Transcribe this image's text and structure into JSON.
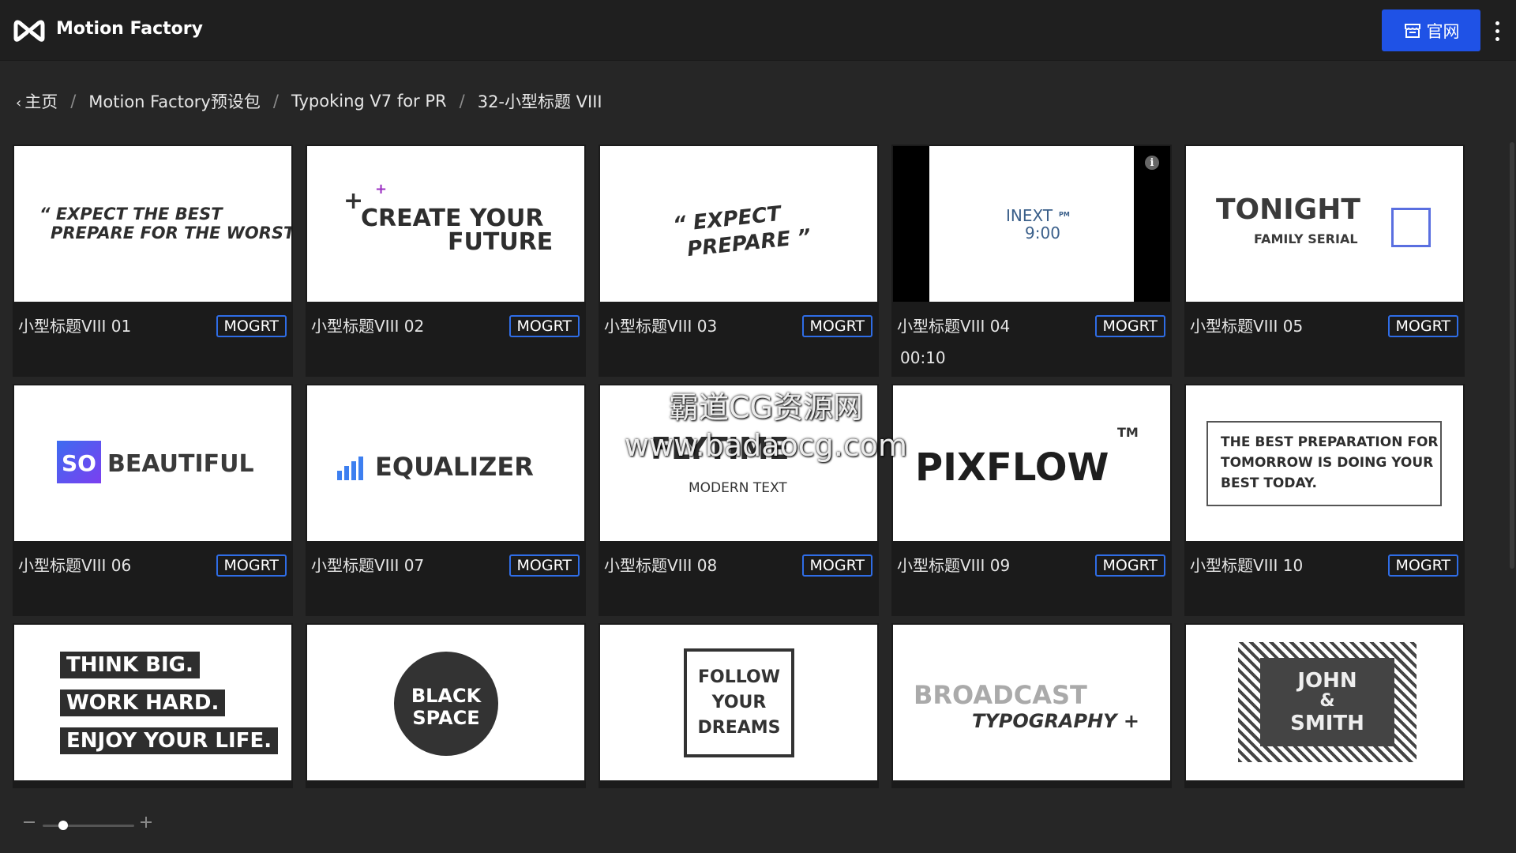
{
  "header": {
    "app_title": "Motion Factory",
    "web_button_label": "官网",
    "icons": {
      "logo": "motion-factory-logo",
      "web": "storefront-icon",
      "more": "more-vertical-icon"
    }
  },
  "breadcrumb": {
    "items": [
      "主页",
      "Motion Factory预设包",
      "Typoking V7 for PR",
      "32-小型标题 VIII"
    ],
    "separator": "/"
  },
  "cards": [
    {
      "label": "小型标题VIII 01",
      "badge": "MOGRT",
      "thumb": {
        "lines": [
          "“ EXPECT THE BEST",
          "PREPARE FOR THE WORST ”"
        ]
      }
    },
    {
      "label": "小型标题VIII 02",
      "badge": "MOGRT",
      "thumb": {
        "lines": [
          "CREATE YOUR",
          "FUTURE"
        ]
      }
    },
    {
      "label": "小型标题VIII 03",
      "badge": "MOGRT",
      "thumb": {
        "lines": [
          "“ EXPECT",
          "PREPARE ”"
        ]
      }
    },
    {
      "label": "小型标题VIII 04",
      "badge": "MOGRT",
      "time": "00:10",
      "thumb": {
        "lines": [
          "INEXT",
          "9:00"
        ],
        "sup": "PM"
      }
    },
    {
      "label": "小型标题VIII 05",
      "badge": "MOGRT",
      "thumb": {
        "lines": [
          "TONIGHT",
          "FAMILY SERIAL"
        ]
      }
    },
    {
      "label": "小型标题VIII 06",
      "badge": "MOGRT",
      "thumb": {
        "lines": [
          "SO",
          "BEAUTIFUL"
        ]
      }
    },
    {
      "label": "小型标题VIII 07",
      "badge": "MOGRT",
      "thumb": {
        "lines": [
          "EQUALIZER"
        ]
      }
    },
    {
      "label": "小型标题VIII 08",
      "badge": "MOGRT",
      "thumb": {
        "lines": [
          "FLYTIME",
          "MODERN TEXT"
        ]
      }
    },
    {
      "label": "小型标题VIII 09",
      "badge": "MOGRT",
      "thumb": {
        "lines": [
          "PIXFLOW",
          "TM"
        ]
      }
    },
    {
      "label": "小型标题VIII 10",
      "badge": "MOGRT",
      "thumb": {
        "lines": [
          "THE BEST PREPARATION FOR",
          "TOMORROW IS DOING YOUR",
          "BEST TODAY."
        ]
      }
    },
    {
      "label": "",
      "badge": "",
      "thumb": {
        "lines": [
          "THINK BIG.",
          "WORK HARD.",
          "ENJOY YOUR LIFE."
        ]
      }
    },
    {
      "label": "",
      "badge": "",
      "thumb": {
        "lines": [
          "BLACK",
          "SPACE"
        ]
      }
    },
    {
      "label": "",
      "badge": "",
      "thumb": {
        "lines": [
          "FOLLOW",
          "YOUR",
          "DREAMS"
        ]
      }
    },
    {
      "label": "",
      "badge": "",
      "thumb": {
        "lines": [
          "BROADCAST",
          "TYPOGRAPHY +"
        ]
      }
    },
    {
      "label": "",
      "badge": "",
      "thumb": {
        "lines": [
          "JOHN",
          "&",
          "SMITH"
        ]
      }
    }
  ],
  "watermark": {
    "line1": "霸道CG资源网",
    "line2": "www.badaocg.com"
  },
  "zoom": {
    "level": 0.2
  },
  "colors": {
    "accent": "#1f52e6",
    "badge_border": "#2f6de6",
    "background": "#262626",
    "card": "#1b1b1b"
  }
}
